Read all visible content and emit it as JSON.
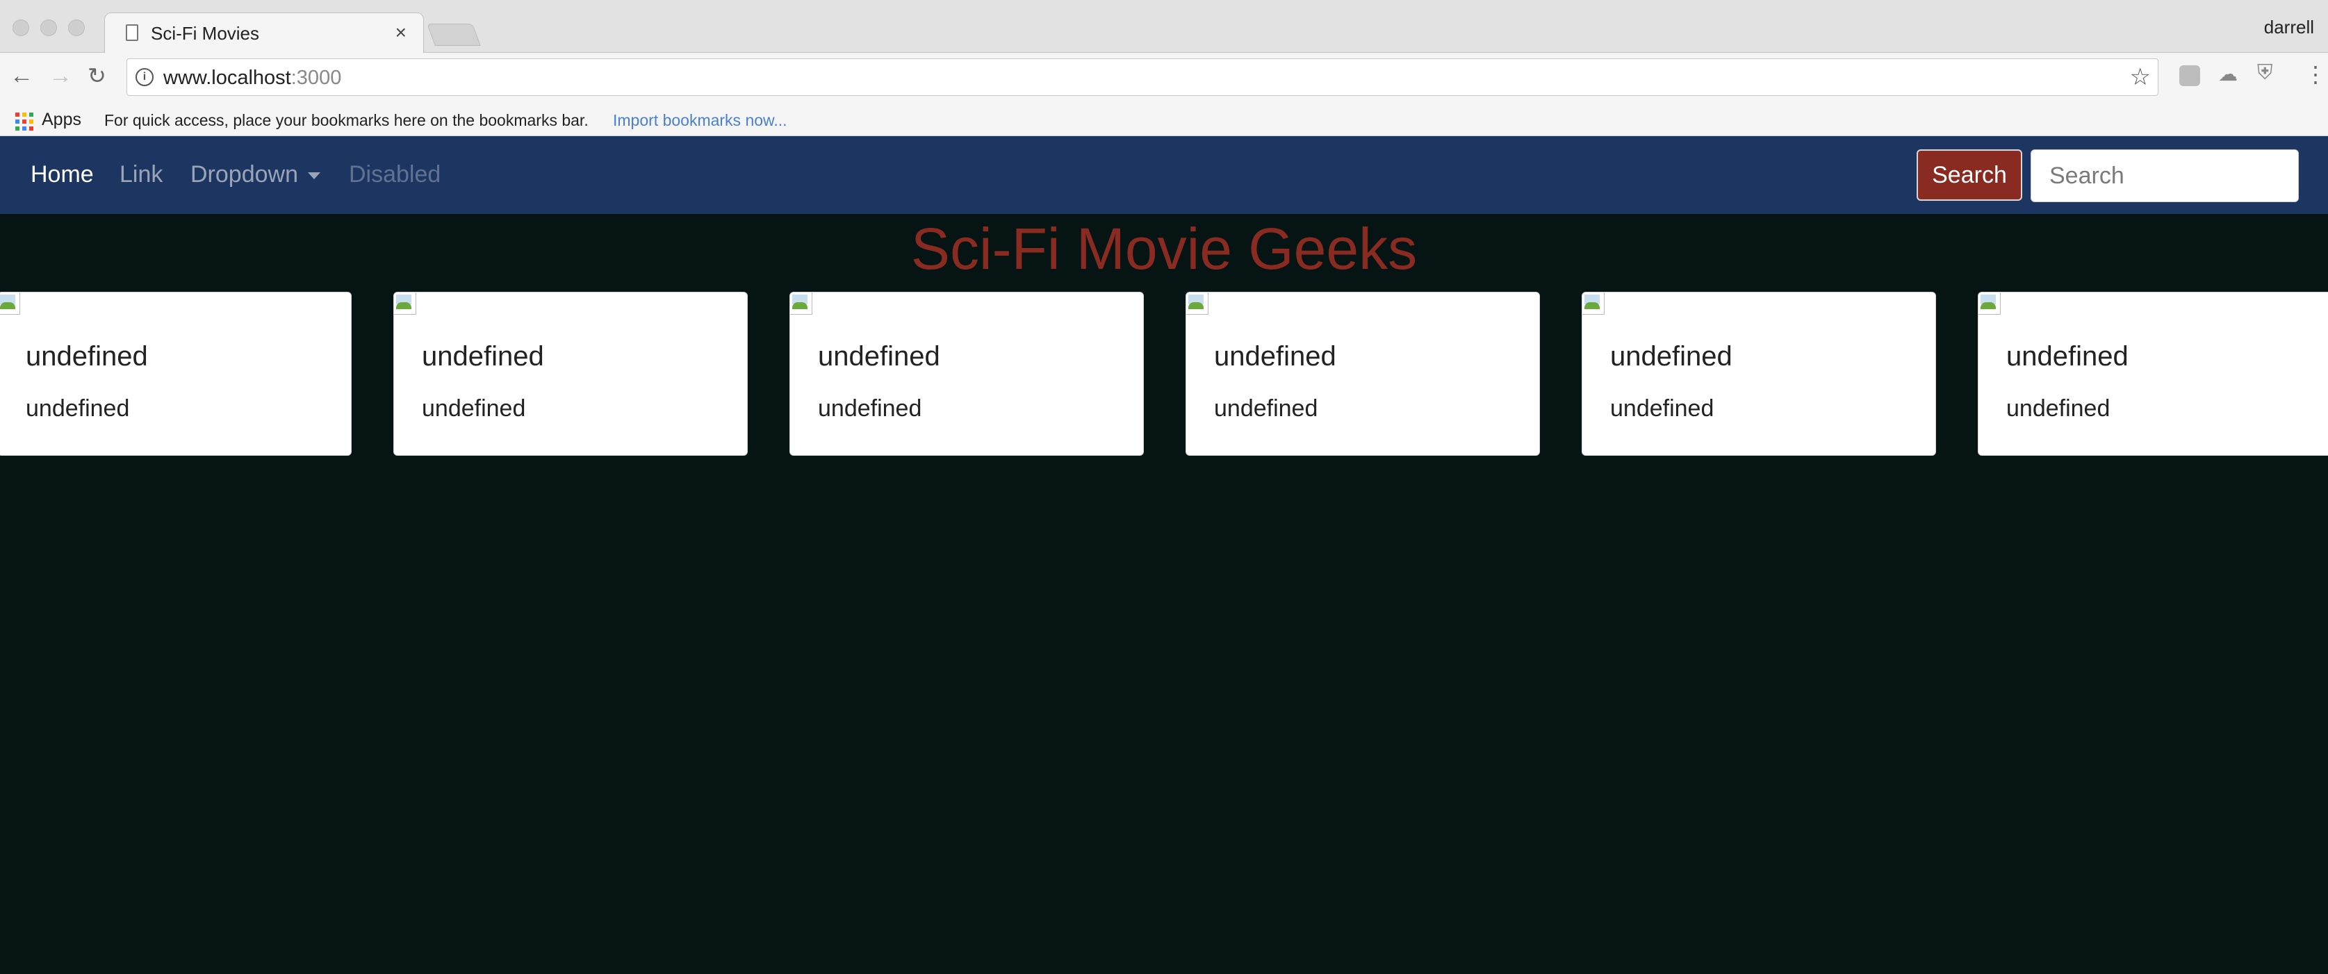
{
  "browser": {
    "tab_title": "Sci-Fi Movies",
    "tab_close": "×",
    "profile_name": "darrell",
    "url_host": "www.localhost",
    "url_port": ":3000",
    "bookmarks": {
      "apps_label": "Apps",
      "message": "For quick access, place your bookmarks here on the bookmarks bar.",
      "import_link": "Import bookmarks now..."
    }
  },
  "navbar": {
    "home": "Home",
    "link": "Link",
    "dropdown": "Dropdown",
    "disabled": "Disabled",
    "search_button": "Search",
    "search_placeholder": "Search"
  },
  "main": {
    "title": "Sci-Fi Movie Geeks",
    "cards": [
      {
        "title": "undefined",
        "text": "undefined"
      },
      {
        "title": "undefined",
        "text": "undefined"
      },
      {
        "title": "undefined",
        "text": "undefined"
      },
      {
        "title": "undefined",
        "text": "undefined"
      },
      {
        "title": "undefined",
        "text": "undefined"
      },
      {
        "title": "undefined",
        "text": "undefined"
      }
    ]
  },
  "colors": {
    "page_bg": "#061414",
    "navbar_bg": "#1d3561",
    "accent": "#8a2b22"
  }
}
